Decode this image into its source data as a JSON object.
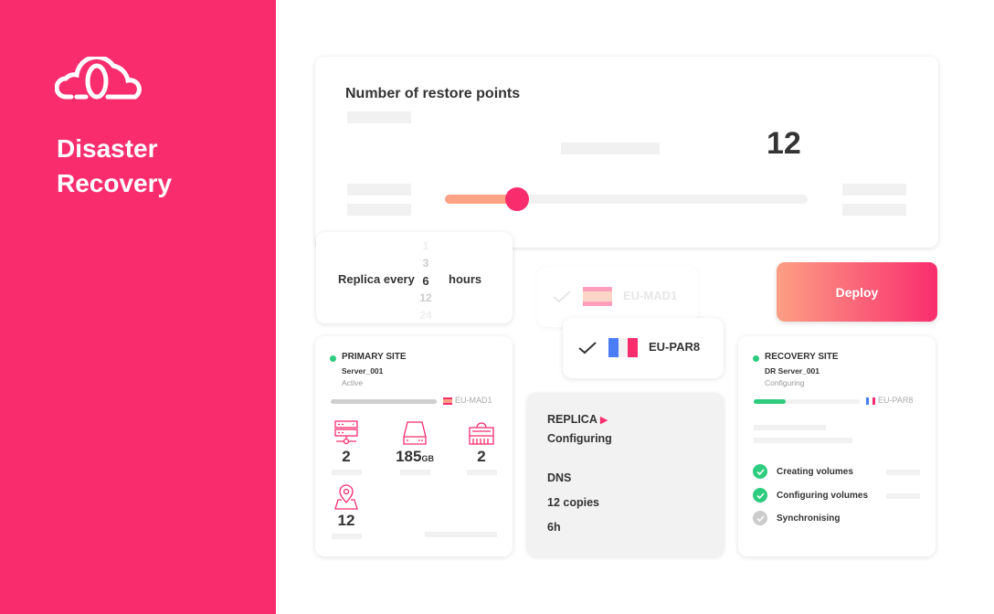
{
  "brand": {
    "title_line1": "Disaster",
    "title_line2": "Recovery",
    "icon": "cloud-icon",
    "color": "#f92d6e"
  },
  "restore_points": {
    "title": "Number of restore points",
    "value": "12",
    "slider_fraction": 0.2
  },
  "replica_frequency": {
    "label_before": "Replica every",
    "label_after": "hours",
    "options": [
      "1",
      "3",
      "6",
      "12",
      "24"
    ],
    "selected": "6"
  },
  "regions": [
    {
      "code": "EU-MAD1",
      "flag": "spain-flag-icon",
      "selected": false
    },
    {
      "code": "EU-PAR8",
      "flag": "france-flag-icon",
      "selected": true
    }
  ],
  "deploy": {
    "label": "Deploy"
  },
  "primary_site": {
    "heading": "PRIMARY SITE",
    "server": "Server_001",
    "status": "Active",
    "region": "EU-MAD1",
    "metrics": [
      {
        "icon": "server-network-icon",
        "value": "2",
        "unit": ""
      },
      {
        "icon": "hard-drive-icon",
        "value": "185",
        "unit": "GB"
      },
      {
        "icon": "memory-chip-icon",
        "value": "2",
        "unit": ""
      },
      {
        "icon": "location-map-icon",
        "value": "12",
        "unit": ""
      }
    ]
  },
  "replica": {
    "title": "REPLICA",
    "status": "Configuring",
    "dns": "DNS",
    "copies": "12 copies",
    "interval": "6h"
  },
  "recovery_site": {
    "heading": "RECOVERY SITE",
    "server": "DR Server_001",
    "status": "Configuring",
    "region": "EU-PAR8",
    "progress": 0.3,
    "steps": [
      {
        "label": "Creating volumes",
        "done": true
      },
      {
        "label": "Configuring volumes",
        "done": true
      },
      {
        "label": "Synchronising",
        "done": false
      }
    ]
  },
  "colors": {
    "accent": "#f92d6e",
    "accent_light": "#fca385",
    "success": "#2ecc7f",
    "pending": "#cccccc"
  }
}
